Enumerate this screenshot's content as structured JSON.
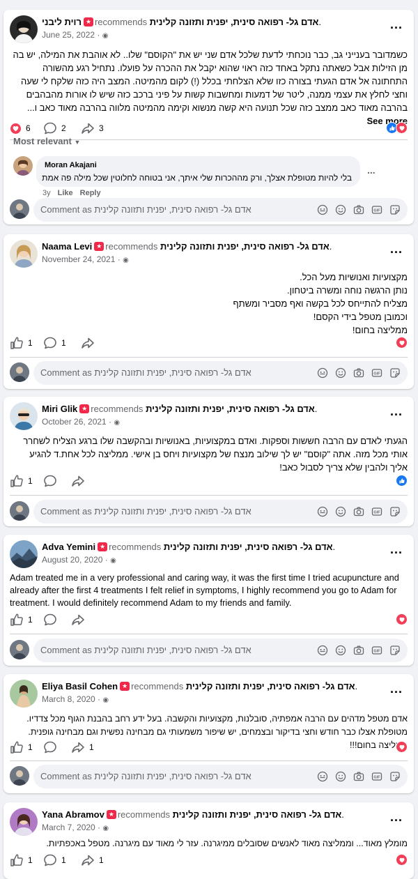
{
  "page": "אדם גל- רפואה סינית, יפנית ותזונה קלינית",
  "common": {
    "recommends": "recommends",
    "comment_placeholder": "Comment as אדם גל- רפואה סינית, יפנית ותזונה קלינית",
    "more": "...",
    "see_more": "See more",
    "most_relevant": "Most relevant"
  },
  "reviews": [
    {
      "author": "רוית ליבני",
      "date": "June 25, 2022 ·",
      "text": "כשמדובר בענייני גב, כבר נוכחתי לדעת שלכל אדם שני יש את \"הקוסם\" שלו.. לא אוהבת את המילה, יש בה מן הזילות אבל כשאתה נתקל באחד כזה ראוי שהוא יקבל את ההכרה על פועלו. נתחיל רגע מהשורה התחתונה אל אדם הגעתי בצורה כזו שלא הצלחתי בכלל (!) לקום מהמיטה. המצב היה כזה שלקח לי שעה וחצי לחלץ את עצמי ממנה, ליטר של דמעות ומחשבות קשות על פיני ברכב כזה שיש לו אורות מהבהבים בהרבה מאוד כאב ממצב כזה שכל תנועה היא קשה מנשוא וקימה מהמיטה מלווה בהרבה מאוד כאב ו...",
      "reactions": "6",
      "comments": "2",
      "shares": "3"
    },
    {
      "author": "Naama Levi",
      "date": "November 24, 2021 ·",
      "text": "מקצועיות ואנושיות מעל הכל.\nנותן הרגשה נוחה ומשרה ביטחון.\nמצליח להתייחס לכל בקשה ואף מסביר ומשתף\nוכמובן מטפל בידי הקסם!\nממליצה בחום!",
      "reactions": "1",
      "comments": "1"
    },
    {
      "author": "Miri Glik",
      "date": "October 26, 2021 ·",
      "text": "הגעתי לאדם עם הרבה חששות וספקות. ואדם במקצועיות, באנושיות ובהקשבה שלו ברגע הצליח לשחרר אותי מכל מזה. אתה \"קוסם\" יש לך שילוב מנצח של מקצועיות ויחס בן אישי. ממליצה לכל אחת.ד להגיע אליך ולהבין שלא צריך לסבול כאב!",
      "reactions": "1"
    },
    {
      "author": "Adva Yemini",
      "date": "August 20, 2020 ·",
      "text": "Adam treated me in a very professional and caring way, it was the first time I tried acupuncture and already after the first 4 treatments I felt relief in symptoms, I highly recommend you go to Adam for treatment. I would definitely recommend Adam to my friends and family.",
      "reactions": "1"
    },
    {
      "author": "Eliya Basil Cohen",
      "date": "March 8, 2020 ·",
      "text": "אדם מטפל מדהים עם הרבה אמפתיה, סובלנות, מקצועיות והקשבה. בעל ידע רחב בהבנת הגוף מכל צדדיו. מטופלת אצלו כבר חודש וחצי בדיקור ובצמחים, יש שיפור משמעותי גם מבחינה נפשית וגם מבחינה גופנית. ממליצה בחום!!!",
      "reactions": "1",
      "shares": "1"
    },
    {
      "author": "Yana Abramov",
      "date": "March 7, 2020 ·",
      "text": "מומלץ מאוד... וממליצה מאוד לאנשים שסובלים ממיגרנה. עזר לי מאוד עם מיגרנה. מטפל באכפתיות.",
      "reactions": "1",
      "comments": "1",
      "shares": "1"
    }
  ],
  "comment": {
    "author": "Moran Akajani",
    "text": "בלי להיות מטופלת אצלך, ורק מההכרות שלי איתך, אני בטוחה לחלוטין שכל מילה פה אמת",
    "age": "3y",
    "like": "Like",
    "reply": "Reply"
  }
}
